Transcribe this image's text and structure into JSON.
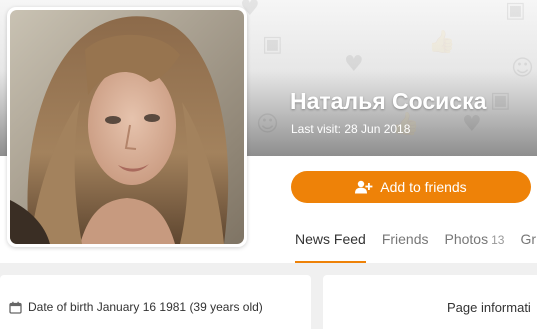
{
  "profile": {
    "name": "Наталья Сосиска",
    "last_visit": "Last visit: 28 Jun 2018"
  },
  "actions": {
    "add_friends_label": "Add to friends"
  },
  "tabs": [
    {
      "label": "News Feed",
      "active": true
    },
    {
      "label": "Friends",
      "active": false
    },
    {
      "label": "Photos",
      "count": "13",
      "active": false
    },
    {
      "label": "Gr",
      "active": false
    }
  ],
  "info": {
    "date_of_birth": "Date of birth January 16 1981 (39 years old)",
    "page_information": "Page informati"
  },
  "theme": {
    "accent": "#ee8208",
    "background": "#f0f0f0"
  },
  "icons": {
    "add_friend": "add-friend-icon",
    "calendar": "calendar-icon",
    "cover_decor": [
      "photo-icon",
      "heart-icon",
      "thumbs-up-icon",
      "smile-icon"
    ]
  }
}
